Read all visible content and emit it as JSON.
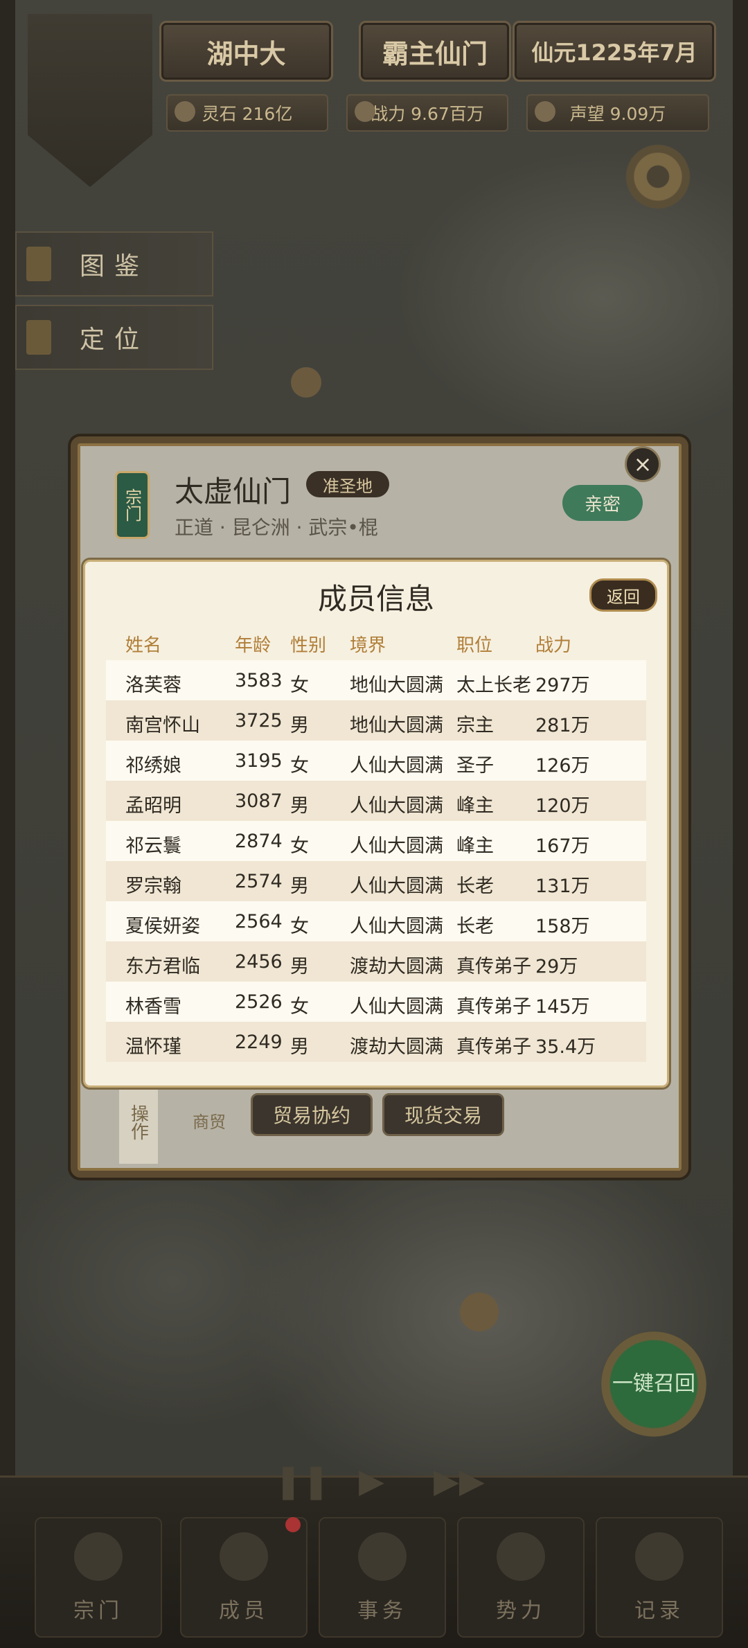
{
  "top_bar": {
    "location": "湖中大",
    "title": "霸主仙门",
    "date": "仙元1225年7月",
    "resources": [
      {
        "name": "spirit-stone",
        "label": "灵石 216亿"
      },
      {
        "name": "power",
        "label": "战力 9.67百万"
      },
      {
        "name": "prestige",
        "label": "声望 9.09万"
      }
    ]
  },
  "side_buttons": {
    "atlas": "图鉴",
    "locate": "定位"
  },
  "sect": {
    "tag": "宗门",
    "name": "太虚仙门",
    "rank": "准圣地",
    "subtitle": "正道 · 昆仑洲 · 武宗•棍",
    "relation": "亲密",
    "close": "×",
    "operations_tab": "操作",
    "trade_label": "商贸",
    "trade_agreement": "贸易协约",
    "spot_trade": "现货交易"
  },
  "members": {
    "title": "成员信息",
    "back": "返回",
    "columns": [
      "姓名",
      "年龄",
      "性别",
      "境界",
      "职位",
      "战力"
    ],
    "rows": [
      [
        "洛芙蓉",
        "3583",
        "女",
        "地仙大圆满",
        "太上长老",
        "297万"
      ],
      [
        "南宫怀山",
        "3725",
        "男",
        "地仙大圆满",
        "宗主",
        "281万"
      ],
      [
        "祁绣娘",
        "3195",
        "女",
        "人仙大圆满",
        "圣子",
        "126万"
      ],
      [
        "孟昭明",
        "3087",
        "男",
        "人仙大圆满",
        "峰主",
        "120万"
      ],
      [
        "祁云鬟",
        "2874",
        "女",
        "人仙大圆满",
        "峰主",
        "167万"
      ],
      [
        "罗宗翰",
        "2574",
        "男",
        "人仙大圆满",
        "长老",
        "131万"
      ],
      [
        "夏侯妍姿",
        "2564",
        "女",
        "人仙大圆满",
        "长老",
        "158万"
      ],
      [
        "东方君临",
        "2456",
        "男",
        "渡劫大圆满",
        "真传弟子",
        "29万"
      ],
      [
        "林香雪",
        "2526",
        "女",
        "人仙大圆满",
        "真传弟子",
        "145万"
      ],
      [
        "温怀瑾",
        "2249",
        "男",
        "渡劫大圆满",
        "真传弟子",
        "35.4万"
      ]
    ]
  },
  "recall": "一键召回",
  "bottom_nav": [
    {
      "label": "宗门",
      "icon": "sect-icon"
    },
    {
      "label": "成员",
      "icon": "member-icon"
    },
    {
      "label": "事务",
      "icon": "affairs-icon"
    },
    {
      "label": "势力",
      "icon": "faction-icon"
    },
    {
      "label": "记录",
      "icon": "record-icon"
    }
  ],
  "speed_controls": [
    "pause-icon",
    "play-icon",
    "fast-forward-icon"
  ]
}
